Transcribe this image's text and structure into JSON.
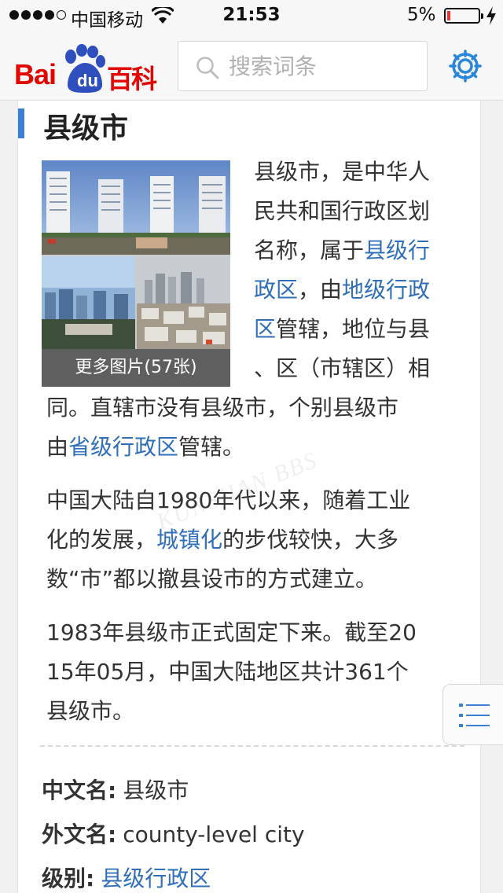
{
  "status_bar": {
    "carrier": "中国移动",
    "time": "21:53",
    "battery": "5%"
  },
  "header": {
    "logo_bai": "Bai",
    "logo_du": "du",
    "logo_baike": "百科",
    "search_placeholder": "搜索词条"
  },
  "article": {
    "title": "县级市",
    "gallery_more": "更多图片(57张)",
    "para1": {
      "l1": "县级市，是中华人",
      "l2": "民共和国行政区划",
      "l3a": "名称，属于",
      "l3_link": "县级行",
      "l4_link": "政区",
      "l4b": "，由",
      "l4_link2": "地级行政",
      "l5_link": "区",
      "l5b": "管辖，地位与县",
      "l6": "、区（市辖区）相",
      "l7": "同。直辖市没有县级市，个别县级市",
      "l8a": "由",
      "l8_link": "省级行政区",
      "l8b": "管辖。"
    },
    "para2": {
      "l1": "中国大陆自1980年代以来，随着工业",
      "l2a": "化的发展，",
      "l2_link": "城镇化",
      "l2b": "的步伐较快，大多",
      "l3": "数“市”都以撤县设市的方式建立。"
    },
    "para3": {
      "l1": "1983年县级市正式固定下来。截至20",
      "l2": "15年05月，中国大陆地区共计361个",
      "l3": "县级市。"
    },
    "info": {
      "chinese_name_key": "中文名:",
      "chinese_name_val": "县级市",
      "foreign_name_key": "外文名:",
      "foreign_name_val": "county-level city",
      "level_key": "级别:",
      "level_val": "县级行政区"
    },
    "watermark": "KUNSHAN BBS"
  },
  "colors": {
    "link": "#2f6eb8",
    "accent": "#3b7fd4",
    "brand_red": "#e10602",
    "brand_blue": "#2f6eb8"
  }
}
